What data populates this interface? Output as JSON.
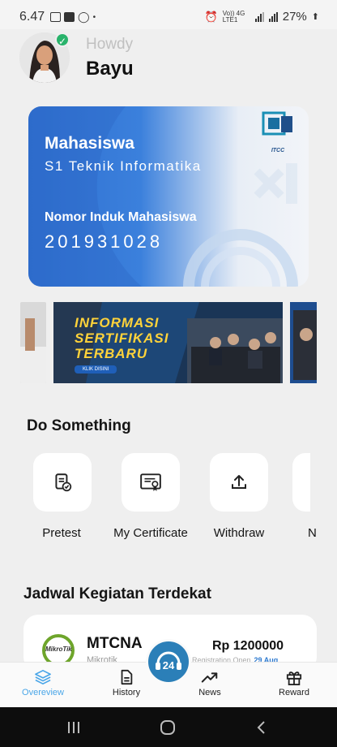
{
  "status_bar": {
    "time": "6.47",
    "network_label": "Vo)) 4G LTE1",
    "battery": "27%"
  },
  "header": {
    "greeting": "Howdy",
    "user_name": "Bayu"
  },
  "id_card": {
    "role": "Mahasiswa",
    "program": "S1 Teknik Informatika",
    "nim_label": "Nomor Induk Mahasiswa",
    "nim": "201931028",
    "logo_text": "ITCC"
  },
  "banner": {
    "line1": "INFORMASI",
    "line2": "SERTIFIKASI",
    "line3": "TERBARU",
    "button": "KLIK DISINI"
  },
  "do_something": {
    "title": "Do Something",
    "actions": [
      {
        "label": "Pretest",
        "icon": "clipboard-check-icon"
      },
      {
        "label": "My Certificate",
        "icon": "certificate-icon"
      },
      {
        "label": "Withdraw",
        "icon": "upload-icon"
      },
      {
        "label": "N",
        "icon": "partial-icon"
      }
    ]
  },
  "schedule": {
    "title": "Jadwal Kegiatan Terdekat",
    "items": [
      {
        "name": "MTCNA",
        "vendor": "Mikrotik",
        "logo_text": "MikroTik",
        "price": "Rp 1200000",
        "status": "Registration Open",
        "date": "29 Aug"
      }
    ]
  },
  "fab": {
    "label": "24"
  },
  "bottom_nav": [
    {
      "label": "Overeview",
      "icon": "layers-icon",
      "active": true
    },
    {
      "label": "History",
      "icon": "document-icon",
      "active": false
    },
    {
      "label": "News",
      "icon": "trending-up-icon",
      "active": false
    },
    {
      "label": "Reward",
      "icon": "gift-icon",
      "active": false
    }
  ],
  "colors": {
    "accent": "#4aa6e8",
    "card_blue": "#2f6fd0",
    "banner_yellow": "#ffd33a",
    "fab": "#2b7fb8",
    "verified": "#29b36b"
  }
}
